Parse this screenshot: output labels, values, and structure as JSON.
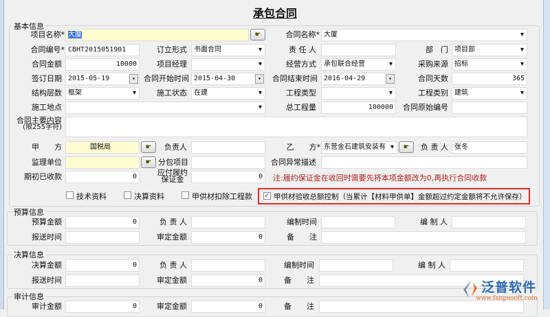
{
  "title": "承包合同",
  "basic": {
    "group": "基本信息",
    "project_name_label": "项目名称*",
    "project_name": "大厦",
    "contract_name_label": "合同名称*",
    "contract_name": "大厦",
    "contract_no_label": "合同编号*",
    "contract_no": "CBHT2015051901",
    "sign_form_label": "订立形式",
    "sign_form": "书面合同",
    "owner_label": "责 任 人",
    "owner": "",
    "dept_label": "部　门",
    "dept": "项目部",
    "amount_label": "合同金额",
    "amount": "10000",
    "pm_label": "项目经理",
    "pm": "",
    "biz_mode_label": "经营方式",
    "biz_mode": "承包联合经营",
    "purchase_label": "采购来源",
    "purchase": "招标",
    "sign_date_label": "签订日期",
    "sign_date": "2015-05-19",
    "start_label": "合同开始时间",
    "start": "2015-04-30",
    "end_label": "合同结束时间",
    "end": "2016-04-29",
    "days_label": "合同天数",
    "days": "365",
    "structure_label": "结构层数",
    "structure": "框架",
    "status_label": "施工状态",
    "status": "在建",
    "eng_type_label": "工程类型",
    "eng_type": "",
    "eng_cat_label": "工程类别",
    "eng_cat": "建筑",
    "site_label": "施工地点",
    "site": "",
    "qty_label": "总工程量",
    "qty": "100000",
    "orig_no_label": "合同原始编号",
    "orig_no": "",
    "content_label": "合同主要内容",
    "content_hint": "(限255字符)",
    "party_a_label": "甲　　方",
    "party_a": "国税局",
    "a_person_label": "负责人",
    "a_person": "",
    "party_b_label": "乙　　方*",
    "party_b": "东营金石建筑安装有",
    "b_person_label": "负 责 人",
    "b_person": "张冬",
    "supervisor_label": "监理单位",
    "supervisor": "",
    "subpkg_label": "分包项目",
    "subpkg": "",
    "abnormal_label": "合同异常描述",
    "abnormal": "",
    "init_recv_label": "期初已收款",
    "init_recv": "0",
    "deposit_label": "应付履约保证金",
    "deposit": "0",
    "note": "注:履约保证金在收回时需要先将本项金额改为0,再执行合同收款",
    "cb_tech": "技术资料",
    "cb_settle": "决算资料",
    "cb_deduct": "甲供材扣除工程款",
    "cb_control": "甲供材验收总额控制（当累计【材料甲供单】金额超过约定金额将不允许保存）"
  },
  "budget": {
    "group": "预算信息",
    "amount_label": "预算金额",
    "amount": "0",
    "person_label": "负 责 人",
    "time_label": "编制时间",
    "maker_label": "编 制 人",
    "send_label": "报送时间",
    "approved_label": "审定金额",
    "approved": "0",
    "remark_label": "备　　注"
  },
  "settle": {
    "group": "决算信息",
    "amount_label": "决算金额",
    "amount": "0",
    "person_label": "负 责 人",
    "time_label": "编制时间",
    "maker_label": "编 制 人",
    "send_label": "报送时间",
    "approved_label": "审定金额",
    "approved": "0",
    "remark_label": "备　　注"
  },
  "audit": {
    "group": "审计信息",
    "amount_label": "审计金额",
    "amount": "0",
    "approved_label": "审定金额",
    "approved": "0",
    "remark_label": "备　　注"
  },
  "logo": {
    "name": "泛普软件",
    "url": "www.fanpusoft.com"
  }
}
